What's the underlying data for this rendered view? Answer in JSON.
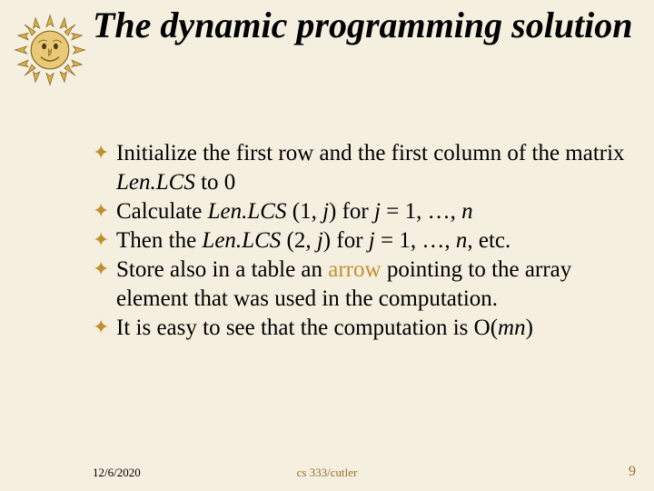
{
  "title": "The dynamic programming solution",
  "bullets": [
    {
      "parts": [
        {
          "text": "Initialize the first row and the first column of the matrix ",
          "style": ""
        },
        {
          "text": "Len.LCS",
          "style": "italic"
        },
        {
          "text": " to 0",
          "style": ""
        }
      ]
    },
    {
      "parts": [
        {
          "text": "Calculate ",
          "style": ""
        },
        {
          "text": "Len.LCS",
          "style": "italic"
        },
        {
          "text": " (1, ",
          "style": ""
        },
        {
          "text": "j",
          "style": "italic"
        },
        {
          "text": ") for ",
          "style": ""
        },
        {
          "text": "j",
          "style": "italic"
        },
        {
          "text": " = 1, …, ",
          "style": ""
        },
        {
          "text": "n",
          "style": "italic"
        }
      ]
    },
    {
      "parts": [
        {
          "text": "Then the ",
          "style": ""
        },
        {
          "text": "Len.LCS",
          "style": "italic"
        },
        {
          "text": " (2, ",
          "style": ""
        },
        {
          "text": "j",
          "style": "italic"
        },
        {
          "text": ") for ",
          "style": ""
        },
        {
          "text": "j",
          "style": "italic"
        },
        {
          "text": " = 1, …, ",
          "style": ""
        },
        {
          "text": "n",
          "style": "italic"
        },
        {
          "text": ", etc.",
          "style": ""
        }
      ]
    },
    {
      "parts": [
        {
          "text": "Store also in a table an ",
          "style": ""
        },
        {
          "text": "arrow",
          "style": "arrow-word"
        },
        {
          "text": " pointing to the array element that was used in the computation.",
          "style": ""
        }
      ]
    },
    {
      "parts": [
        {
          "text": "It is easy to see that the computation is O(",
          "style": ""
        },
        {
          "text": "mn",
          "style": "italic"
        },
        {
          "text": ")",
          "style": ""
        }
      ]
    }
  ],
  "footer": {
    "date": "12/6/2020",
    "center": "cs 333/cutler",
    "page": "9"
  },
  "icons": {
    "sun": "sun-face-icon"
  }
}
